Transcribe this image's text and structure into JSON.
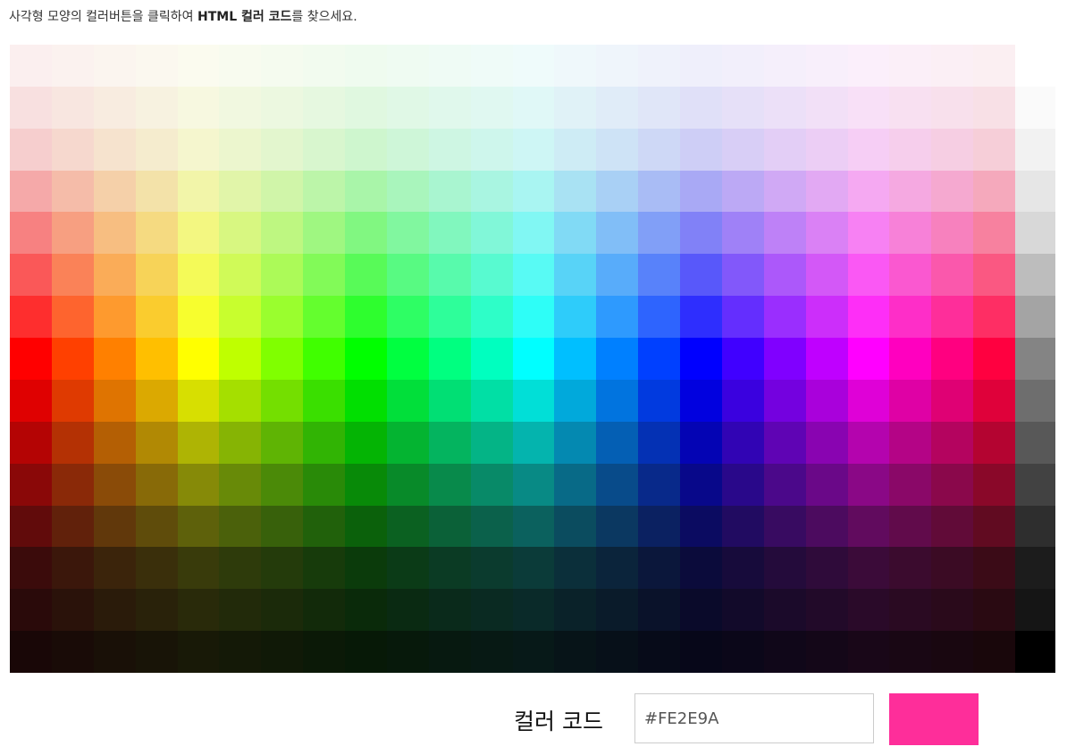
{
  "instruction": {
    "prefix": "사각형 모양의 컬러버튼을 클릭하여 ",
    "bold": "HTML 컬러 코드",
    "suffix": "를 찾으세요."
  },
  "palette": {
    "rows": [
      [
        "#FBEFEF",
        "#FBF2EF",
        "#FBF5EF",
        "#FBF8EF",
        "#FBFBEF",
        "#F8FBEF",
        "#F5FBEF",
        "#F2FBEF",
        "#EFFBEF",
        "#EFFBF2",
        "#EFFBF5",
        "#EFFBF8",
        "#EFFBFB",
        "#EFF8FB",
        "#EFF5FB",
        "#EFF2FB",
        "#EFEFFB",
        "#F2EFFB",
        "#F5EFFB",
        "#F8EFFB",
        "#FBEFFB",
        "#FBEFF8",
        "#FBEFF5",
        "#FBEFF2",
        "#FFFFFF"
      ],
      [
        "#F8E0E0",
        "#F8E6E0",
        "#F8ECE0",
        "#F7F2E0",
        "#F7F8E0",
        "#F1F8E0",
        "#ECF8E0",
        "#E6F8E0",
        "#E0F8E0",
        "#E0F8E6",
        "#E0F8EC",
        "#E0F8F1",
        "#E0F8F7",
        "#E0F2F7",
        "#E0ECF8",
        "#E0E6F8",
        "#E0E0F8",
        "#E6E0F8",
        "#ECE0F8",
        "#F2E0F7",
        "#F8E0F7",
        "#F8E0F1",
        "#F8E0EC",
        "#F8E0E6",
        "#FAFAFA"
      ],
      [
        "#F6CECE",
        "#F6D8CE",
        "#F6E3CE",
        "#F5ECCE",
        "#F5F6CE",
        "#ECF6CE",
        "#E3F6CE",
        "#D8F6CE",
        "#CEF6CE",
        "#CEF6D8",
        "#CEF6E3",
        "#CEF6EC",
        "#CEF6F5",
        "#CEECF5",
        "#CEE3F6",
        "#CED8F6",
        "#CECEF6",
        "#D8CEF6",
        "#E3CEF6",
        "#ECCEF5",
        "#F6CEF5",
        "#F6CEEC",
        "#F6CEE3",
        "#F6CED8",
        "#F2F2F2"
      ],
      [
        "#F5A9A9",
        "#F5BCA9",
        "#F5D0A9",
        "#F3E2A9",
        "#F2F5A9",
        "#E1F5A9",
        "#D0F5A9",
        "#BCF5A9",
        "#A9F5A9",
        "#A9F5BC",
        "#A9F5D0",
        "#A9F5E1",
        "#A9F5F2",
        "#A9E2F3",
        "#A9D0F5",
        "#A9BCF5",
        "#A9A9F5",
        "#BCA9F5",
        "#D0A9F5",
        "#E2A9F3",
        "#F5A9F2",
        "#F5A9E1",
        "#F5A9D0",
        "#F5A9BC",
        "#E6E6E6"
      ],
      [
        "#F78181",
        "#F79F81",
        "#F7BE81",
        "#F5DA81",
        "#F3F781",
        "#D8F781",
        "#BEF781",
        "#9FF781",
        "#81F781",
        "#81F79F",
        "#81F7BE",
        "#81F7D8",
        "#81F7F3",
        "#81DAF5",
        "#81BEF7",
        "#819FF7",
        "#8181F7",
        "#9F81F7",
        "#BE81F7",
        "#DA81F5",
        "#F781F3",
        "#F781D8",
        "#F781BE",
        "#F7819F",
        "#D8D8D8"
      ],
      [
        "#FA5858",
        "#FA8258",
        "#FAAC58",
        "#F7D358",
        "#F4FA58",
        "#D0FA58",
        "#ACFA58",
        "#82FA58",
        "#58FA58",
        "#58FA82",
        "#58FAAC",
        "#58FAD0",
        "#58FAF4",
        "#58D3F7",
        "#58ACFA",
        "#5882FA",
        "#5858FA",
        "#8258FA",
        "#AC58FA",
        "#D358F7",
        "#FA58F4",
        "#FA58D0",
        "#FA58AC",
        "#FA5882",
        "#BDBDBD"
      ],
      [
        "#FE2E2E",
        "#FE642E",
        "#FE9A2E",
        "#FACC2E",
        "#F7FE2E",
        "#C8FE2E",
        "#9AFE2E",
        "#64FE2E",
        "#2EFE2E",
        "#2EFE64",
        "#2EFE9A",
        "#2EFEC8",
        "#2EFEF7",
        "#2ECCFA",
        "#2E9AFE",
        "#2E64FE",
        "#2E2EFE",
        "#642EFE",
        "#9A2EFE",
        "#CC2EFA",
        "#FE2EF7",
        "#FE2EC8",
        "#FE2E9A",
        "#FE2E64",
        "#A4A4A4"
      ],
      [
        "#FF0000",
        "#FF4000",
        "#FF8000",
        "#FFBF00",
        "#FFFF00",
        "#BFFF00",
        "#80FF00",
        "#40FF00",
        "#00FF00",
        "#00FF40",
        "#00FF80",
        "#00FFBF",
        "#00FFFF",
        "#00BFFF",
        "#0080FF",
        "#0040FF",
        "#0000FF",
        "#4000FF",
        "#8000FF",
        "#BF00FF",
        "#FF00FF",
        "#FF00BF",
        "#FF0080",
        "#FF0040",
        "#848484"
      ],
      [
        "#DF0101",
        "#DF3A01",
        "#DF7401",
        "#DBA901",
        "#D7DF01",
        "#A5DF00",
        "#74DF00",
        "#3ADF00",
        "#01DF01",
        "#01DF3A",
        "#01DF74",
        "#01DFA5",
        "#01DFD7",
        "#01A9DB",
        "#0174DF",
        "#013ADF",
        "#0101DF",
        "#3A01DF",
        "#7401DF",
        "#A901DB",
        "#DF01D7",
        "#DF01A5",
        "#DF0174",
        "#DF013A",
        "#6E6E6E"
      ],
      [
        "#B40404",
        "#B43104",
        "#B45F04",
        "#B18904",
        "#AEB404",
        "#86B404",
        "#5FB404",
        "#31B404",
        "#04B404",
        "#04B431",
        "#04B45F",
        "#04B486",
        "#04B4AE",
        "#0489B1",
        "#045FB4",
        "#0431B4",
        "#0404B4",
        "#3104B4",
        "#5F04B4",
        "#8904B1",
        "#B404AE",
        "#B40486",
        "#B4045F",
        "#B40431",
        "#585858"
      ],
      [
        "#8A0808",
        "#8A2908",
        "#8A4B08",
        "#886A08",
        "#868A08",
        "#688A08",
        "#4B8A08",
        "#298A08",
        "#088A08",
        "#088A29",
        "#088A4B",
        "#088A68",
        "#088A85",
        "#086A87",
        "#084B8A",
        "#08298A",
        "#08088A",
        "#29088A",
        "#4B088A",
        "#6A0888",
        "#8A0886",
        "#8A0868",
        "#8A084B",
        "#8A0829",
        "#424242"
      ],
      [
        "#610B0B",
        "#61210B",
        "#61380B",
        "#5F4C0B",
        "#5E610B",
        "#4B610B",
        "#38610B",
        "#21610B",
        "#0B610B",
        "#0B6121",
        "#0B6138",
        "#0B614B",
        "#0B615E",
        "#0B4C5F",
        "#0B3861",
        "#0B2161",
        "#0B0B61",
        "#210B61",
        "#380B61",
        "#4C0B5F",
        "#610B5E",
        "#610B4B",
        "#610B38",
        "#610B21",
        "#2E2E2E"
      ],
      [
        "#3B0B0B",
        "#3B170B",
        "#3B240B",
        "#3A2F0B",
        "#393B0B",
        "#2E3B0B",
        "#243B0B",
        "#173B0B",
        "#0B3B0B",
        "#0B3B17",
        "#0B3B24",
        "#0B3B2E",
        "#0B3B39",
        "#0B2F3A",
        "#0B243B",
        "#0B173B",
        "#0B0B3B",
        "#170B3B",
        "#240B3B",
        "#2F0B3A",
        "#3B0B39",
        "#3B0B2E",
        "#3B0B24",
        "#3B0B17",
        "#1C1C1C"
      ],
      [
        "#2A0A0A",
        "#2A120A",
        "#2A1B0A",
        "#29220A",
        "#292A0A",
        "#222A0A",
        "#1B2A0A",
        "#122A0A",
        "#0A2A0A",
        "#0A2A12",
        "#0A2A1B",
        "#0A2A22",
        "#0A2A29",
        "#0A2229",
        "#0A1B2A",
        "#0A122A",
        "#0A0A2A",
        "#120A2A",
        "#1B0A2A",
        "#220A29",
        "#2A0A29",
        "#2A0A22",
        "#2A0A1B",
        "#2A0A12",
        "#151515"
      ],
      [
        "#190707",
        "#190B07",
        "#191007",
        "#181407",
        "#181907",
        "#141907",
        "#101907",
        "#0B1907",
        "#071907",
        "#07190B",
        "#071910",
        "#071914",
        "#071918",
        "#071418",
        "#071019",
        "#070B19",
        "#070719",
        "#0B0719",
        "#100719",
        "#140718",
        "#190718",
        "#190714",
        "#190710",
        "#19070B",
        "#000000"
      ]
    ]
  },
  "color_code": {
    "label": "컬러 코드",
    "value": "#FE2E9A",
    "preview_color": "#FE2E9A"
  }
}
